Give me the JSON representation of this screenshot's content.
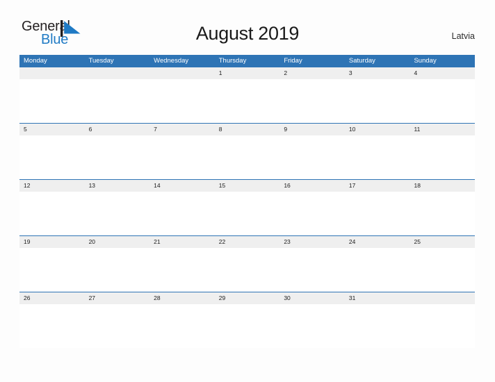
{
  "brand": {
    "name_part1": "General",
    "name_part2": "Blue",
    "flag_icon": "blue-triangle-flag-icon",
    "color_dark": "#231f20",
    "color_blue": "#1f7ac4"
  },
  "header": {
    "title": "August 2019",
    "country": "Latvia"
  },
  "calendar": {
    "accent_color": "#2e74b5",
    "band_color": "#efefef",
    "weekdays": [
      "Monday",
      "Tuesday",
      "Wednesday",
      "Thursday",
      "Friday",
      "Saturday",
      "Sunday"
    ],
    "weeks": [
      [
        "",
        "",
        "",
        "1",
        "2",
        "3",
        "4"
      ],
      [
        "5",
        "6",
        "7",
        "8",
        "9",
        "10",
        "11"
      ],
      [
        "12",
        "13",
        "14",
        "15",
        "16",
        "17",
        "18"
      ],
      [
        "19",
        "20",
        "21",
        "22",
        "23",
        "24",
        "25"
      ],
      [
        "26",
        "27",
        "28",
        "29",
        "30",
        "31",
        ""
      ]
    ]
  }
}
